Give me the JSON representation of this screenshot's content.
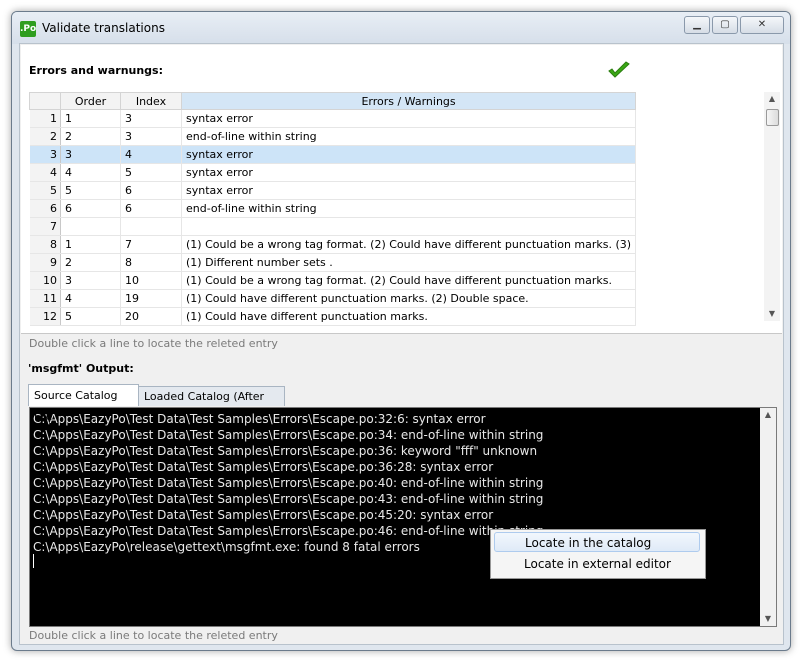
{
  "window": {
    "app_icon_text": ".Po",
    "title": "Validate translations"
  },
  "errors_panel": {
    "heading": "Errors and warnungs:",
    "columns": [
      "Order",
      "Index",
      "Errors / Warnings"
    ],
    "rows": [
      {
        "n": "1",
        "order": "1",
        "index": "3",
        "msg": "syntax error"
      },
      {
        "n": "2",
        "order": "2",
        "index": "3",
        "msg": "end-of-line within string"
      },
      {
        "n": "3",
        "order": "3",
        "index": "4",
        "msg": "syntax error"
      },
      {
        "n": "4",
        "order": "4",
        "index": "5",
        "msg": "syntax error"
      },
      {
        "n": "5",
        "order": "5",
        "index": "6",
        "msg": "syntax error"
      },
      {
        "n": "6",
        "order": "6",
        "index": "6",
        "msg": "end-of-line within string"
      },
      {
        "n": "7",
        "order": "",
        "index": "",
        "msg": ""
      },
      {
        "n": "8",
        "order": "1",
        "index": "7",
        "msg": "(1) Could be a wrong tag format. (2) Could have different punctuation marks. (3)"
      },
      {
        "n": "9",
        "order": "2",
        "index": "8",
        "msg": "(1) Different number sets ."
      },
      {
        "n": "10",
        "order": "3",
        "index": "10",
        "msg": "(1) Could be a wrong tag format. (2) Could have different punctuation marks."
      },
      {
        "n": "11",
        "order": "4",
        "index": "19",
        "msg": "(1) Could have different punctuation marks. (2) Double space."
      },
      {
        "n": "12",
        "order": "5",
        "index": "20",
        "msg": "(1) Could have different punctuation marks."
      }
    ],
    "selected_row": 3,
    "hint": "Double click a line to locate the releted entry"
  },
  "output_panel": {
    "heading": "'msgfmt' Output:",
    "tabs": [
      "Source Catalog File",
      "Loaded Catalog  (After Save)"
    ],
    "active_tab": 0,
    "lines": [
      "C:\\Apps\\EazyPo\\Test Data\\Test Samples\\Errors\\Escape.po:32:6: syntax error",
      "C:\\Apps\\EazyPo\\Test Data\\Test Samples\\Errors\\Escape.po:34: end-of-line within string",
      "C:\\Apps\\EazyPo\\Test Data\\Test Samples\\Errors\\Escape.po:36: keyword \"fff\" unknown",
      "C:\\Apps\\EazyPo\\Test Data\\Test Samples\\Errors\\Escape.po:36:28: syntax error",
      "C:\\Apps\\EazyPo\\Test Data\\Test Samples\\Errors\\Escape.po:40: end-of-line within string",
      "C:\\Apps\\EazyPo\\Test Data\\Test Samples\\Errors\\Escape.po:43: end-of-line within string",
      "C:\\Apps\\EazyPo\\Test Data\\Test Samples\\Errors\\Escape.po:45:20: syntax error",
      "C:\\Apps\\EazyPo\\Test Data\\Test Samples\\Errors\\Escape.po:46: end-of-line within string",
      "C:\\Apps\\EazyPo\\release\\gettext\\msgfmt.exe: found 8 fatal errors"
    ],
    "hint": "Double click a line to locate the releted entry"
  },
  "context_menu": {
    "items": [
      "Locate in the catalog",
      "Locate in external editor"
    ]
  },
  "colors": {
    "accent_selection": "#cde4f8",
    "console_bg": "#000000",
    "console_text": "#e8e8e8",
    "check_green": "#3aa815"
  }
}
